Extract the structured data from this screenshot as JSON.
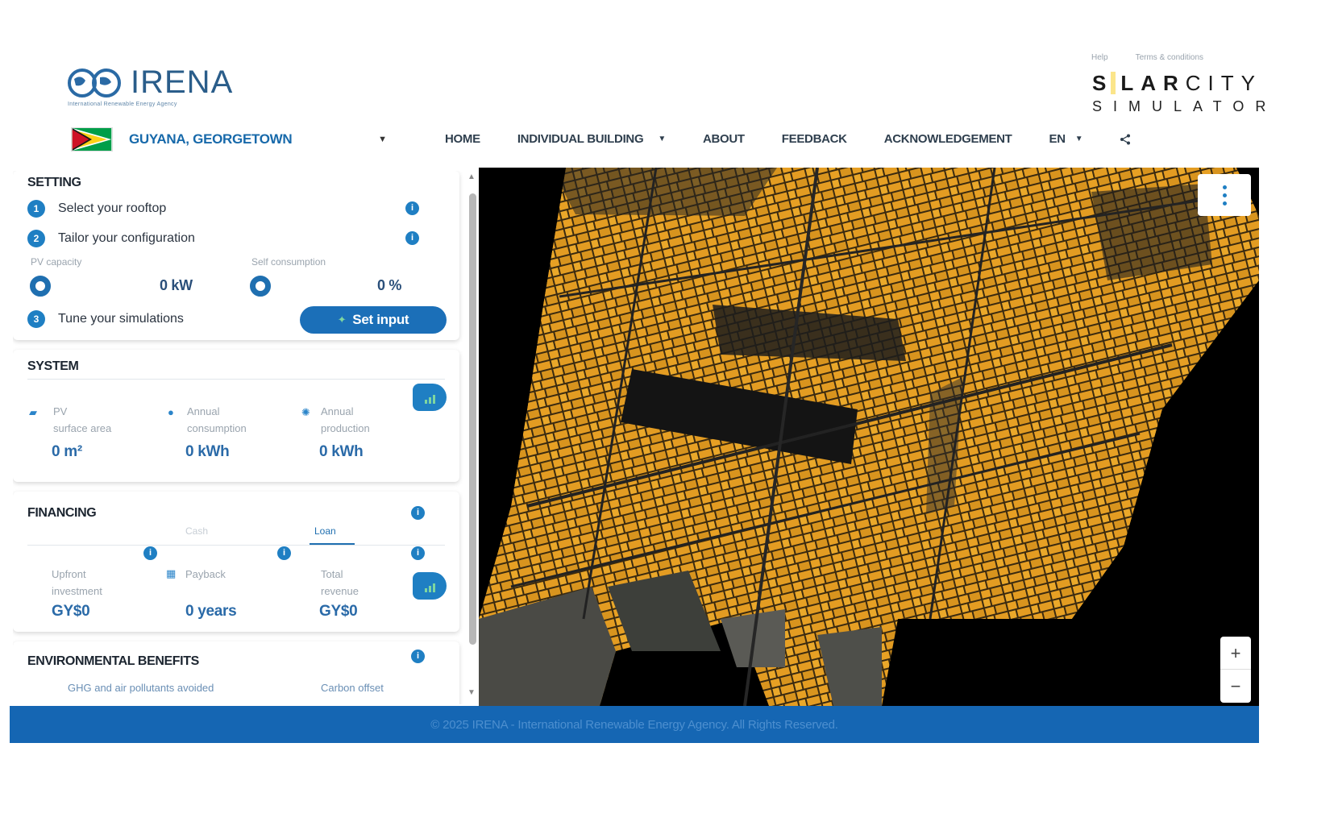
{
  "header": {
    "logo_text": "IRENA",
    "logo_tagline": "International Renewable Energy Agency",
    "top_links": [
      "Help",
      "Terms & conditions"
    ],
    "brand": {
      "line1_bold_a": "S",
      "line1_bold_b": "LAR",
      "line1_thin": "CITY",
      "line2": "SIMULATOR"
    },
    "location": "GUYANA, GEORGETOWN",
    "nav": {
      "home": "HOME",
      "individual_building": "INDIVIDUAL BUILDING",
      "about": "ABOUT",
      "feedback": "FEEDBACK",
      "acknowledgement": "ACKNOWLEDGEMENT",
      "language": "EN"
    }
  },
  "setting": {
    "title": "SETTING",
    "step1": {
      "num": "1",
      "label": "Select your rooftop"
    },
    "step2": {
      "num": "2",
      "label": "Tailor your configuration"
    },
    "pv_capacity_label": "PV capacity",
    "pv_capacity_value": "0 kW",
    "self_consumption_label": "Self consumption",
    "self_consumption_value": "0 %",
    "step3": {
      "num": "3",
      "label": "Tune your simulations"
    },
    "set_input_label": "Set input"
  },
  "system": {
    "title": "SYSTEM",
    "pv_label_1": "PV",
    "pv_label_2": "surface area",
    "pv_value": "0 m²",
    "consumption_label_1": "Annual",
    "consumption_label_2": "consumption",
    "consumption_value": "0 kWh",
    "production_label_1": "Annual",
    "production_label_2": "production",
    "production_value": "0 kWh"
  },
  "financing": {
    "title": "FINANCING",
    "tab_cash": "Cash",
    "tab_loan": "Loan",
    "upfront_label_1": "Upfront",
    "upfront_label_2": "investment",
    "upfront_value": "GY$0",
    "payback_label": "Payback",
    "payback_value": "0 years",
    "revenue_label_1": "Total",
    "revenue_label_2": "revenue",
    "revenue_value": "GY$0"
  },
  "environment": {
    "title": "ENVIRONMENTAL BENEFITS",
    "ghg_label": "GHG and air pollutants avoided",
    "carbon_label": "Carbon offset"
  },
  "map": {
    "zoom_in": "+",
    "zoom_out": "−"
  },
  "footer": {
    "text": "© 2025 IRENA - International Renewable Energy Agency. All Rights Reserved."
  },
  "colors": {
    "accent": "#1f7fc3",
    "footer_bg": "#1566b3",
    "rooftop": "#e7a024",
    "map_bg": "#000000"
  },
  "icons": [
    "globe-logo-icon",
    "sun-icon",
    "guyana-flag-icon",
    "chevron-down-icon",
    "share-icon",
    "info-icon",
    "chart-icon",
    "surface-icon",
    "drop-icon",
    "sun-production-icon",
    "calendar-icon",
    "menu-dots-icon",
    "zoom-in-icon",
    "zoom-out-icon"
  ]
}
